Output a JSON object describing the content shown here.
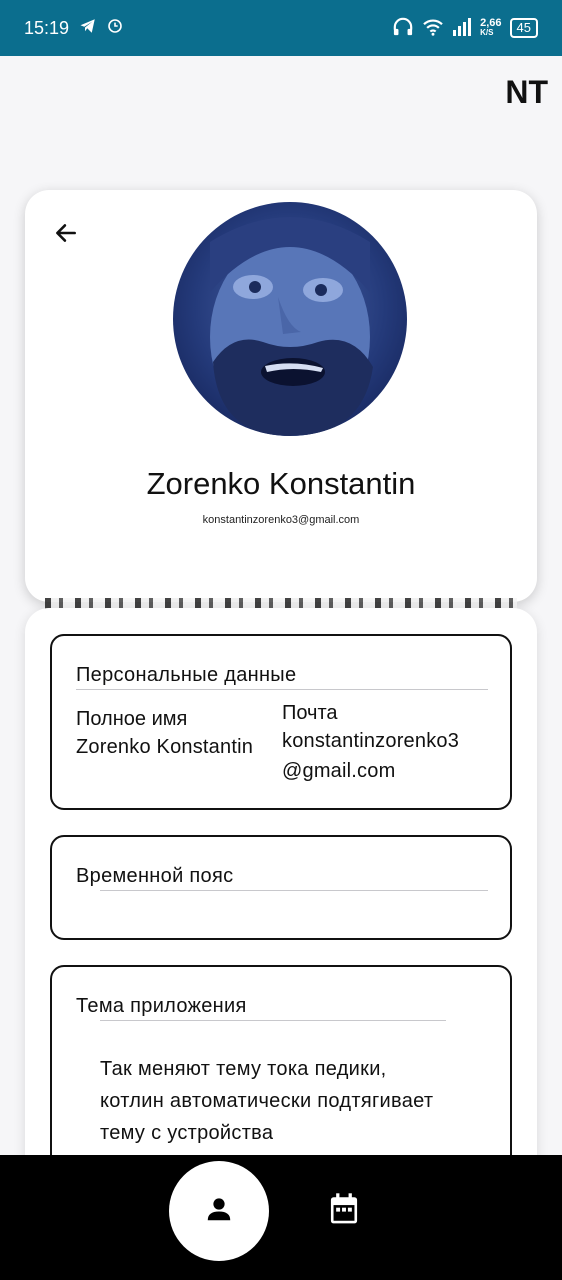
{
  "status_bar": {
    "time": "15:19",
    "network_speed_value": "2,66",
    "network_speed_unit": "K/S",
    "battery": "45",
    "icons": [
      "telegram-icon",
      "sync-icon",
      "headphones-icon",
      "wifi-icon",
      "signal-icon",
      "battery-icon"
    ]
  },
  "header": {
    "brand": "NT"
  },
  "profile": {
    "name": "Zorenko Konstantin",
    "email": "konstantinzorenko3@gmail.com",
    "back_icon": "arrow-left-icon"
  },
  "sections": {
    "personal": {
      "title": "Персональные данные",
      "full_name_label": "Полное имя",
      "full_name_value": "Zorenko Konstantin",
      "email_label": "Почта",
      "email_value_line1": "konstantinzorenko3",
      "email_value_line2": "@gmail.com"
    },
    "timezone": {
      "title": "Временной пояс"
    },
    "theme": {
      "title": "Тема приложения",
      "text_line1": "Так меняют тему тока педики,",
      "text_line2": "котлин автоматически подтягивает",
      "text_line3": "тему с устройства"
    }
  },
  "bottom_nav": {
    "items": [
      {
        "name": "profile",
        "icon": "person-icon",
        "active": true
      },
      {
        "name": "calendar",
        "icon": "calendar-icon",
        "active": false
      }
    ]
  },
  "colors": {
    "status_bar_bg": "#0b6e8e",
    "card_bg": "#ffffff",
    "nav_bg": "#000000",
    "page_bg": "#f6f6f8"
  }
}
